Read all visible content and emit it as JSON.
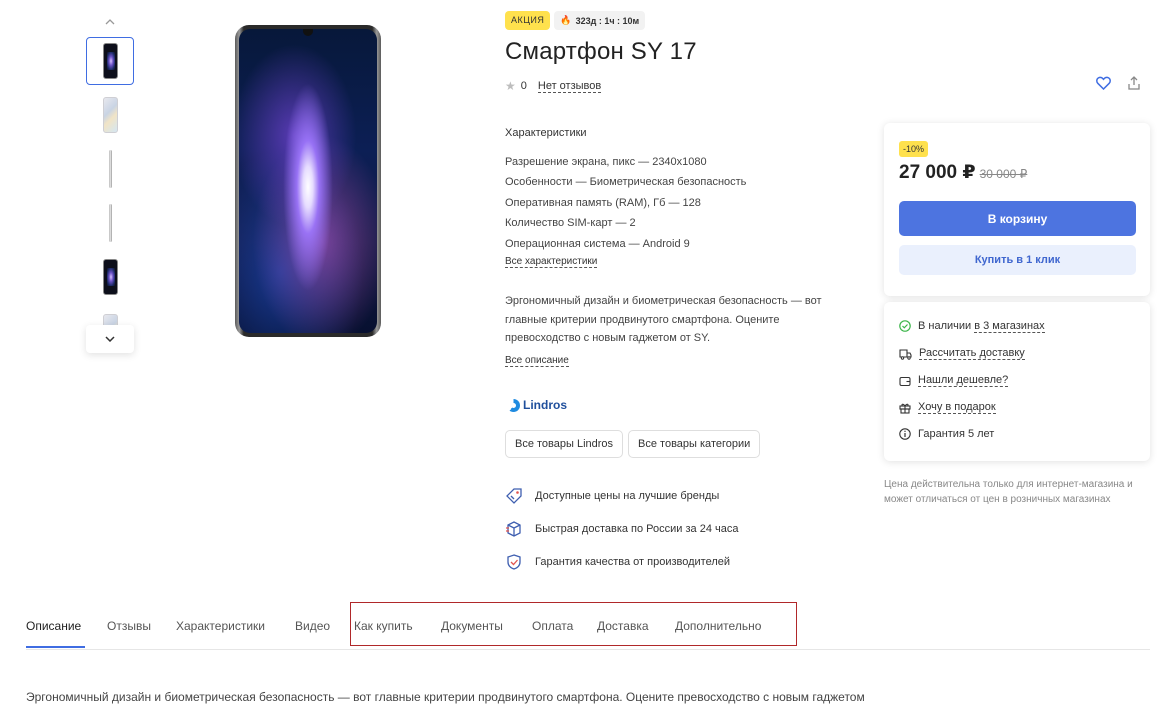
{
  "gallery": {
    "thumbnails": [
      {
        "kind": "front",
        "active": true
      },
      {
        "kind": "back",
        "active": false
      },
      {
        "kind": "side",
        "active": false
      },
      {
        "kind": "side",
        "active": false
      },
      {
        "kind": "front",
        "active": false
      },
      {
        "kind": "back-partial",
        "active": false
      }
    ],
    "icons": {
      "up": "chevron-up-icon",
      "down": "chevron-down-icon"
    }
  },
  "product": {
    "promo_badge": "АКЦИЯ",
    "timer": "323д : 1ч : 10м",
    "title": "Смартфон SY 17",
    "rating": "0",
    "reviews_link": "Нет отзывов",
    "chars_title": "Характеристики",
    "chars": [
      "Разрешение экрана, пикс — 2340x1080",
      "Особенности — Биометрическая безопасность",
      "Оперативная память (RAM), Гб — 128",
      "Количество SIM-карт — 2",
      "Операционная система — Android 9"
    ],
    "all_chars_link": "Все характеристики",
    "description_lines": [
      "Эргономичный дизайн и биометрическая безопасность — вот",
      "главные критерии продвинутого смартфона. Оцените",
      "превосходство с новым гаджетом от SY."
    ],
    "all_desc_link": "Все описание",
    "brand": "Lindros",
    "brand_buttons": [
      "Все товары Lindros",
      "Все товары категории"
    ],
    "benefits": [
      "Доступные цены на лучшие бренды",
      "Быстрая доставка по России за 24 часа",
      "Гарантия качества от производителей"
    ]
  },
  "buy": {
    "discount": "-10%",
    "price": "27 000 ₽",
    "old_price": "30 000 ₽",
    "cart_button": "В корзину",
    "one_click_button": "Купить в 1 клик"
  },
  "info": {
    "availability_prefix": "В наличии",
    "availability_link": "в 3 магазинах",
    "delivery": "Рассчитать доставку",
    "cheaper": "Нашли дешевле?",
    "gift": "Хочу в подарок",
    "warranty": "Гарантия 5 лет",
    "note": "Цена действительна только для интернет-магазина и может отличаться от цен в розничных магазинах"
  },
  "tabs": [
    "Описание",
    "Отзывы",
    "Характеристики",
    "Видео",
    "Как купить",
    "Документы",
    "Оплата",
    "Доставка",
    "Дополнительно"
  ],
  "bottom_text": "Эргономичный дизайн и биометрическая безопасность — вот главные критерии продвинутого смартфона. Оцените превосходство с новым гаджетом",
  "colors": {
    "accent": "#4d74e0",
    "promo": "#ffe14d",
    "highlight": "#b0282a"
  }
}
